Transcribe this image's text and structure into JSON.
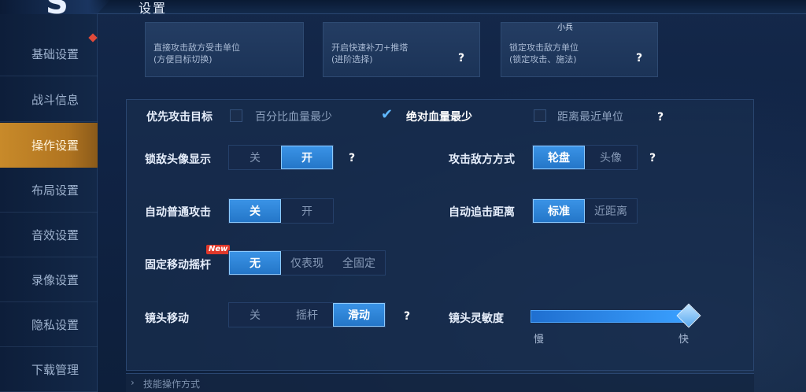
{
  "header": {
    "title": "设置"
  },
  "sidebar": {
    "items": [
      {
        "label": "基础设置",
        "badge": true
      },
      {
        "label": "战斗信息"
      },
      {
        "label": "操作设置",
        "active": true
      },
      {
        "label": "布局设置"
      },
      {
        "label": "音效设置"
      },
      {
        "label": "录像设置"
      },
      {
        "label": "隐私设置"
      },
      {
        "label": "下载管理"
      }
    ]
  },
  "cards": [
    {
      "line1": "直接攻击敌方受击单位",
      "line2": "(方便目标切换)"
    },
    {
      "line1": "开启快速补刀+推塔",
      "line2": "(进阶选择)"
    },
    {
      "line1": "锁定攻击敌方单位",
      "line2": "(锁定攻击、施法)",
      "tag": "小兵"
    }
  ],
  "help": "?",
  "priority_target": {
    "label": "优先攻击目标",
    "options": [
      {
        "label": "百分比血量最少",
        "checked": false
      },
      {
        "label": "绝对血量最少",
        "checked": true
      },
      {
        "label": "距离最近单位",
        "checked": false
      }
    ],
    "check_glyph": "✔"
  },
  "lock_avatar": {
    "label": "锁敌头像显示",
    "off": "关",
    "on": "开",
    "selected": "on"
  },
  "attack_mode": {
    "label": "攻击敌方方式",
    "opt1": "轮盘",
    "opt2": "头像",
    "selected": "opt1"
  },
  "auto_attack": {
    "label": "自动普通攻击",
    "off": "关",
    "on": "开",
    "selected": "off"
  },
  "auto_chase": {
    "label": "自动追击距离",
    "opt1": "标准",
    "opt2": "近距离",
    "selected": "opt1"
  },
  "fixed_joystick": {
    "label": "固定移动摇杆",
    "badge": "New",
    "opt1": "无",
    "opt2": "仅表现",
    "opt3": "全固定",
    "selected": "opt1"
  },
  "camera_move": {
    "label": "镜头移动",
    "opt1": "关",
    "opt2": "摇杆",
    "opt3": "滑动",
    "selected": "opt3"
  },
  "camera_sensitivity": {
    "label": "镜头灵敏度",
    "min_label": "慢",
    "max_label": "快",
    "value": 1.0
  },
  "footer": {
    "text": "技能操作方式",
    "arrow": "›"
  },
  "colors": {
    "accent": "#2476c8",
    "active_tab": "#c88a2a"
  }
}
